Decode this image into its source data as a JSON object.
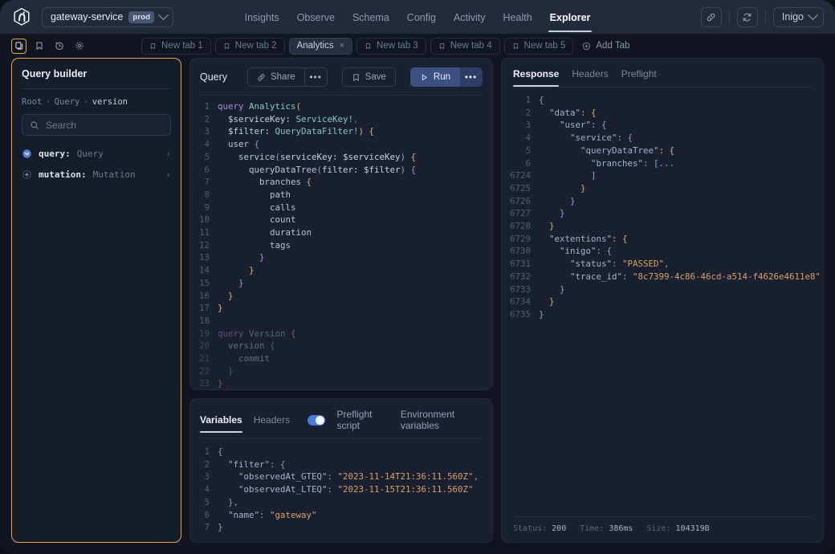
{
  "topbar": {
    "service_name": "gateway-service",
    "service_env": "prod",
    "nav": [
      {
        "label": "Insights",
        "active": false
      },
      {
        "label": "Observe",
        "active": false
      },
      {
        "label": "Schema",
        "active": false
      },
      {
        "label": "Config",
        "active": false
      },
      {
        "label": "Activity",
        "active": false
      },
      {
        "label": "Health",
        "active": false
      },
      {
        "label": "Explorer",
        "active": true
      }
    ],
    "user": "Inigo",
    "accent": "#e8a33d"
  },
  "tabbar": {
    "tools": [
      "docs-icon",
      "bookmark-icon",
      "history-icon",
      "settings-icon"
    ],
    "tabs": [
      {
        "label": "New tab 1",
        "active": false,
        "closable": false
      },
      {
        "label": "New tab 2",
        "active": false,
        "closable": false
      },
      {
        "label": "Analytics",
        "active": true,
        "closable": true
      },
      {
        "label": "New tab 3",
        "active": false,
        "closable": false
      },
      {
        "label": "New tab 4",
        "active": false,
        "closable": false
      },
      {
        "label": "New tab 5",
        "active": false,
        "closable": false
      }
    ],
    "add_tab_label": "Add Tab",
    "close_glyph": "×"
  },
  "query_builder": {
    "title": "Query builder",
    "breadcrumb": [
      "Root",
      "Query",
      "version"
    ],
    "breadcrumb_sep": "›",
    "search_placeholder": "Search",
    "tree": [
      {
        "name": "query:",
        "type": "Query",
        "icon": "chevron-down-filled-icon",
        "arrow": "›"
      },
      {
        "name": "mutation:",
        "type": "Mutation",
        "icon": "plus-circle-icon",
        "arrow": "›"
      }
    ]
  },
  "query_panel": {
    "label": "Query",
    "share_label": "Share",
    "save_label": "Save",
    "run_label": "Run",
    "dots_glyph": "•••",
    "lines": [
      {
        "n": "1",
        "dim": false,
        "tokens": [
          {
            "t": "query ",
            "c": "kw"
          },
          {
            "t": "Analytics",
            "c": "ty2"
          },
          {
            "t": "(",
            "c": "br1"
          }
        ]
      },
      {
        "n": "2",
        "dim": false,
        "tokens": [
          {
            "t": "  $serviceKey: ",
            "c": "var"
          },
          {
            "t": "ServiceKey!",
            "c": "ty2"
          },
          {
            "t": ",",
            "c": "pn"
          }
        ]
      },
      {
        "n": "3",
        "dim": false,
        "tokens": [
          {
            "t": "  $filter: ",
            "c": "var"
          },
          {
            "t": "QueryDataFilter!",
            "c": "ty2"
          },
          {
            "t": ")",
            "c": "br1"
          },
          {
            "t": " {",
            "c": "br1"
          }
        ]
      },
      {
        "n": "4",
        "dim": false,
        "tokens": [
          {
            "t": "  user",
            "c": "fld"
          },
          {
            "t": " {",
            "c": "br2"
          }
        ]
      },
      {
        "n": "5",
        "dim": false,
        "tokens": [
          {
            "t": "    service",
            "c": "fld"
          },
          {
            "t": "(",
            "c": "br3"
          },
          {
            "t": "serviceKey: $serviceKey",
            "c": "var"
          },
          {
            "t": ")",
            "c": "br3"
          },
          {
            "t": " {",
            "c": "br1"
          }
        ]
      },
      {
        "n": "6",
        "dim": false,
        "tokens": [
          {
            "t": "      queryDataTree",
            "c": "fld"
          },
          {
            "t": "(",
            "c": "br3"
          },
          {
            "t": "filter: $filter",
            "c": "var"
          },
          {
            "t": ")",
            "c": "br3"
          },
          {
            "t": " {",
            "c": "br2"
          }
        ]
      },
      {
        "n": "7",
        "dim": false,
        "tokens": [
          {
            "t": "        branches",
            "c": "fld"
          },
          {
            "t": " {",
            "c": "br1"
          }
        ]
      },
      {
        "n": "8",
        "dim": false,
        "tokens": [
          {
            "t": "          path",
            "c": "fld"
          }
        ]
      },
      {
        "n": "9",
        "dim": false,
        "tokens": [
          {
            "t": "          calls",
            "c": "fld"
          }
        ]
      },
      {
        "n": "10",
        "dim": false,
        "tokens": [
          {
            "t": "          count",
            "c": "fld"
          }
        ]
      },
      {
        "n": "11",
        "dim": false,
        "tokens": [
          {
            "t": "          duration",
            "c": "fld"
          }
        ]
      },
      {
        "n": "12",
        "dim": false,
        "tokens": [
          {
            "t": "          tags",
            "c": "fld"
          }
        ]
      },
      {
        "n": "13",
        "dim": false,
        "tokens": [
          {
            "t": "        }",
            "c": "br2"
          }
        ]
      },
      {
        "n": "14",
        "dim": false,
        "tokens": [
          {
            "t": "      }",
            "c": "br1"
          }
        ]
      },
      {
        "n": "15",
        "dim": false,
        "tokens": [
          {
            "t": "    }",
            "c": "br2"
          }
        ]
      },
      {
        "n": "16",
        "dim": false,
        "tokens": [
          {
            "t": "  }",
            "c": "br1"
          }
        ]
      },
      {
        "n": "17",
        "dim": false,
        "tokens": [
          {
            "t": "}",
            "c": "br1"
          }
        ]
      },
      {
        "n": "18",
        "dim": false,
        "tokens": []
      },
      {
        "n": "19",
        "dim": true,
        "tokens": [
          {
            "t": "query ",
            "c": "kw"
          },
          {
            "t": "Version",
            "c": "ty2"
          },
          {
            "t": " {",
            "c": "br1"
          }
        ]
      },
      {
        "n": "20",
        "dim": true,
        "tokens": [
          {
            "t": "  version",
            "c": "fld"
          },
          {
            "t": " {",
            "c": "br2"
          }
        ]
      },
      {
        "n": "21",
        "dim": true,
        "tokens": [
          {
            "t": "    commit",
            "c": "fld"
          }
        ]
      },
      {
        "n": "22",
        "dim": true,
        "tokens": [
          {
            "t": "  }",
            "c": "br2"
          }
        ]
      },
      {
        "n": "23",
        "dim": true,
        "tokens": [
          {
            "t": "}",
            "c": "br1"
          }
        ]
      }
    ]
  },
  "variables_panel": {
    "tabs": [
      {
        "label": "Variables",
        "active": true
      },
      {
        "label": "Headers",
        "active": false
      }
    ],
    "toggle_on": true,
    "preflight_label": "Preflight script",
    "env_label": "Environment variables",
    "lines": [
      {
        "n": "1",
        "tokens": [
          {
            "t": "{",
            "c": "jp"
          }
        ]
      },
      {
        "n": "2",
        "tokens": [
          {
            "t": "  \"filter\"",
            "c": "jk"
          },
          {
            "t": ": {",
            "c": "jp"
          }
        ]
      },
      {
        "n": "3",
        "tokens": [
          {
            "t": "    \"observedAt_GTEQ\"",
            "c": "jk"
          },
          {
            "t": ": ",
            "c": "jp"
          },
          {
            "t": "\"2023-11-14T21:36:11.560Z\"",
            "c": "jv"
          },
          {
            "t": ",",
            "c": "jp"
          }
        ]
      },
      {
        "n": "4",
        "tokens": [
          {
            "t": "    \"observedAt_LTEQ\"",
            "c": "jk"
          },
          {
            "t": ": ",
            "c": "jp"
          },
          {
            "t": "\"2023-11-15T21:36:11.560Z\"",
            "c": "jv"
          }
        ]
      },
      {
        "n": "5",
        "tokens": [
          {
            "t": "  },",
            "c": "jp"
          }
        ]
      },
      {
        "n": "6",
        "tokens": [
          {
            "t": "  \"name\"",
            "c": "jk"
          },
          {
            "t": ": ",
            "c": "jp"
          },
          {
            "t": "\"gateway\"",
            "c": "jv"
          }
        ]
      },
      {
        "n": "7",
        "tokens": [
          {
            "t": "}",
            "c": "jp"
          }
        ]
      }
    ]
  },
  "response_panel": {
    "tabs": [
      {
        "label": "Response",
        "active": true
      },
      {
        "label": "Headers",
        "active": false
      },
      {
        "label": "Preflight",
        "active": false
      }
    ],
    "lines": [
      {
        "n": "1",
        "tokens": [
          {
            "t": "{",
            "c": "jp"
          }
        ]
      },
      {
        "n": "2",
        "tokens": [
          {
            "t": "  \"data\"",
            "c": "jk"
          },
          {
            "t": ": {",
            "c": "br1"
          }
        ]
      },
      {
        "n": "3",
        "tokens": [
          {
            "t": "    \"user\"",
            "c": "jk"
          },
          {
            "t": ": {",
            "c": "br3"
          }
        ]
      },
      {
        "n": "4",
        "tokens": [
          {
            "t": "      \"service\"",
            "c": "jk"
          },
          {
            "t": ": {",
            "c": "br2"
          }
        ]
      },
      {
        "n": "5",
        "tokens": [
          {
            "t": "        \"queryDataTree\"",
            "c": "jk"
          },
          {
            "t": ": {",
            "c": "br1"
          }
        ]
      },
      {
        "n": "6",
        "tokens": [
          {
            "t": "          \"branches\"",
            "c": "jk"
          },
          {
            "t": ": ",
            "c": "jp"
          },
          {
            "t": "[...",
            "c": "br3"
          }
        ]
      },
      {
        "n": "6724",
        "tokens": [
          {
            "t": "          ]",
            "c": "br3"
          }
        ]
      },
      {
        "n": "6725",
        "tokens": [
          {
            "t": "        }",
            "c": "br1"
          }
        ]
      },
      {
        "n": "6726",
        "tokens": [
          {
            "t": "      }",
            "c": "br2"
          }
        ]
      },
      {
        "n": "6727",
        "tokens": [
          {
            "t": "    }",
            "c": "br3"
          }
        ]
      },
      {
        "n": "6728",
        "tokens": [
          {
            "t": "  }",
            "c": "br1"
          }
        ]
      },
      {
        "n": "6729",
        "tokens": [
          {
            "t": "  \"extentions\"",
            "c": "jk"
          },
          {
            "t": ": {",
            "c": "br1"
          }
        ]
      },
      {
        "n": "6730",
        "tokens": [
          {
            "t": "    \"inigo\"",
            "c": "jk"
          },
          {
            "t": ": {",
            "c": "br3"
          }
        ]
      },
      {
        "n": "6731",
        "tokens": [
          {
            "t": "      \"status\"",
            "c": "jk"
          },
          {
            "t": ": ",
            "c": "jp"
          },
          {
            "t": "\"PASSED\"",
            "c": "jv"
          },
          {
            "t": ",",
            "c": "jp"
          }
        ]
      },
      {
        "n": "6732",
        "tokens": [
          {
            "t": "      \"trace_id\"",
            "c": "jk"
          },
          {
            "t": ": ",
            "c": "jp"
          },
          {
            "t": "\"8c7399-4c86-46cd-a514-f4626e4611e8\"",
            "c": "jv"
          }
        ]
      },
      {
        "n": "6733",
        "tokens": [
          {
            "t": "    }",
            "c": "br3"
          }
        ]
      },
      {
        "n": "6734",
        "tokens": [
          {
            "t": "  }",
            "c": "br1"
          }
        ]
      },
      {
        "n": "6735",
        "tokens": [
          {
            "t": "}",
            "c": "jp"
          }
        ]
      }
    ],
    "status": {
      "status_label": "Status:",
      "status_value": "200",
      "time_label": "Time:",
      "time_value": "386ms",
      "size_label": "Size:",
      "size_value": "104319B"
    }
  }
}
